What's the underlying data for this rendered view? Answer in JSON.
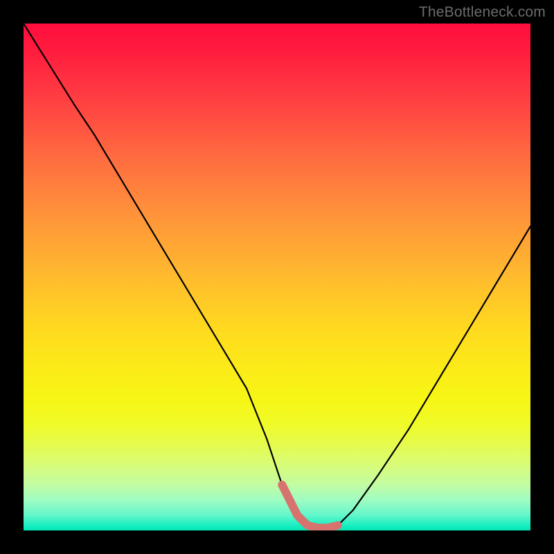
{
  "watermark": "TheBottleneck.com",
  "colors": {
    "frame": "#000000",
    "curve": "#000000",
    "highlight": "#d6736e",
    "gradient_top": "#ff0d3e",
    "gradient_bottom": "#00e6b3"
  },
  "chart_data": {
    "type": "line",
    "title": "",
    "xlabel": "",
    "ylabel": "",
    "xlim": [
      0,
      100
    ],
    "ylim": [
      0,
      100
    ],
    "grid": false,
    "series": [
      {
        "name": "bottleneck-curve",
        "x": [
          0,
          5,
          10,
          14,
          20,
          26,
          32,
          38,
          44,
          48,
          51,
          54,
          56,
          58,
          60,
          62,
          65,
          70,
          76,
          82,
          88,
          94,
          100
        ],
        "y": [
          100,
          92,
          84,
          78,
          68,
          58,
          48,
          38,
          28,
          18,
          9,
          3,
          1,
          0.5,
          0.5,
          1,
          4,
          11,
          20,
          30,
          40,
          50,
          60
        ]
      }
    ],
    "highlight": {
      "name": "flat-minimum",
      "x_range": [
        51,
        62
      ],
      "y": 0.8
    }
  }
}
